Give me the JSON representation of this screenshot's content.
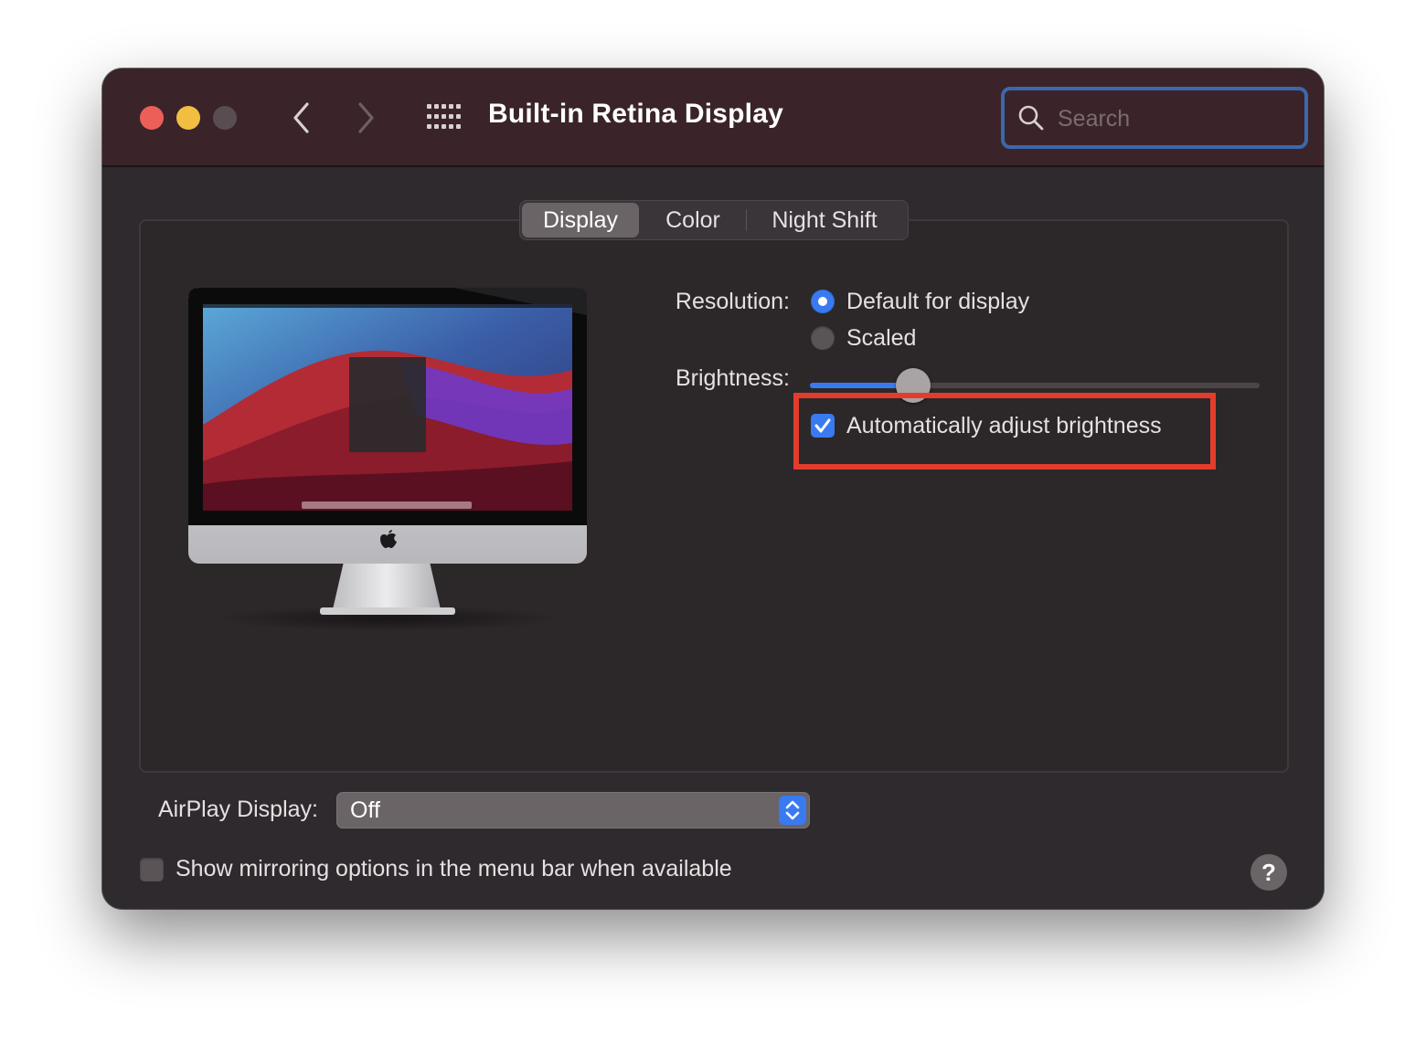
{
  "window": {
    "title": "Built-in Retina Display"
  },
  "toolbar": {
    "back_icon": "chevron-left-icon",
    "forward_icon": "chevron-right-icon",
    "show_all_icon": "grid-icon"
  },
  "search": {
    "placeholder": "Search",
    "value": ""
  },
  "tabs": [
    {
      "label": "Display",
      "active": true
    },
    {
      "label": "Color",
      "active": false
    },
    {
      "label": "Night Shift",
      "active": false
    }
  ],
  "resolution": {
    "label": "Resolution:",
    "options": [
      {
        "label": "Default for display",
        "selected": true
      },
      {
        "label": "Scaled",
        "selected": false
      }
    ]
  },
  "brightness": {
    "label": "Brightness:",
    "level": 0.23,
    "auto_adjust_label": "Automatically adjust brightness",
    "auto_adjust_checked": true
  },
  "airplay": {
    "label": "AirPlay Display:",
    "value": "Off"
  },
  "mirroring": {
    "label": "Show mirroring options in the menu bar when available",
    "checked": false
  },
  "help": {
    "label": "?"
  },
  "colors": {
    "accent": "#3a7af0",
    "highlight": "#e23d2c",
    "titlebar": "#3a2429",
    "window_bg": "#2f2a2d"
  }
}
